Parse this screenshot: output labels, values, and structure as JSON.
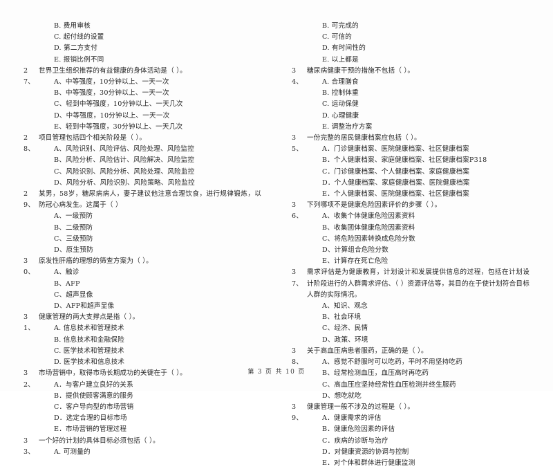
{
  "document": {
    "footer": {
      "prefix": "第",
      "current_page": "3",
      "middle": "页  共",
      "total_pages": "10",
      "suffix": "页"
    }
  },
  "left_column": {
    "continued_options": [
      "B. 费用审核",
      "C. 起付线的设置",
      "D. 第二方支付",
      "E. 报销比例不同"
    ],
    "questions": [
      {
        "number": "27、",
        "stem": "世界卫生组织推荐的有益健康的身体活动是（      ）。",
        "options": [
          "A、中等强度，10分钟以上、一天一次",
          "B、中等强度，30分钟以上、一天一次",
          "C、轻到中等强度，10分钟以上、一天几次",
          "D、中等强度，10分钟以上、一天一次",
          "E、轻到中等强度，30分钟以上、一天几次"
        ]
      },
      {
        "number": "28、",
        "stem": "项目管理包括四个相关阶段是（      ）。",
        "options": [
          "A、风险识别、风险评估、风险处理、风险监控",
          "B、风险分析、风险估计、风险解决、风险监控",
          "C、风险识别、风险分析、风险处理、风险监控",
          "D、风险分析、风险识别、风险策略、风险监控"
        ]
      },
      {
        "number": "29、",
        "stem": "某男，58岁，糖尿病病人，妻子建议他注意合理饮食，进行规律锻炼，以防冠心病发生。这属于（    ）",
        "options": [
          "A、一级预防",
          "B、二级预防",
          "C、三级预防",
          "D、原生预防"
        ]
      },
      {
        "number": "30、",
        "stem": "原发性肝癌的理想的筛查方案为（      ）。",
        "options": [
          "A、触诊",
          "B、AFP",
          "C、超声显像",
          "D、AFP和超声显像"
        ]
      },
      {
        "number": "31、",
        "stem": "健康管理的两大支撑点是指（      ）。",
        "options": [
          "A. 信息技术和管理技术",
          "B. 信息技术和金融保险",
          "C. 医学技术和管理技术",
          "D. 医学技术和信息技术"
        ]
      },
      {
        "number": "32、",
        "stem": "市场营销中，取得市场长期成功的关键在于（      ）。",
        "options": [
          "A．与客户建立良好的关系",
          "B．提供使顾客满意的服务",
          "C．客户导向型的市场营销",
          "D．选定合理的目标市场",
          "E．市场营销的管理过程"
        ]
      },
      {
        "number": "33、",
        "stem": "一个好的计划的具体目标必须包括（       ）。",
        "options": [
          "A. 可测量的"
        ]
      }
    ]
  },
  "right_column": {
    "continued_options": [
      "B. 可完成的",
      "C. 可信的",
      "D. 有时间性的",
      "E. 以上都是"
    ],
    "questions": [
      {
        "number": "34、",
        "stem": "糖尿病健康干预的措施不包括（      ）。",
        "options": [
          "A. 合理膳食",
          "B. 控制体重",
          "C. 运动保健",
          "D. 心理健康",
          "E. 调整治疗方案"
        ]
      },
      {
        "number": "35、",
        "stem": "一份完整的居民健康档案应包括（      ）。",
        "options": [
          "A．门诊健康档案、医院健康档案、社区健康档案",
          "B．个人健康档案、家庭健康档案、社区健康档案P318",
          "C．门诊健康档案、个人健康档案、家庭健康档案",
          "D．个人健康档案、家庭健康档案、医院健康档案",
          "E．个人健康档案、医院健康档案、社区健康档案"
        ]
      },
      {
        "number": "36、",
        "stem": "下列哪项不是健康危险因素评价的步骤（      ）。",
        "options": [
          "A、收集个体健康危险因素资料",
          "B、收集团体健康危险因素资料",
          "C、将危险因素转换成危险分数",
          "D、计算组合危险分数",
          "E、计算存在死亡危险"
        ]
      },
      {
        "number": "37、",
        "stem": "需求评估是为健康教育，计划设计和发展提供信息的过程，包括在计划设计阶段进行的人群需求评估、（      ）资源评估等，其目的在于使计划符合目标人群的实际情况。",
        "options": [
          "A、知识、观念",
          "B、社会环境",
          "C、经济、民情",
          "D、政策、环境"
        ]
      },
      {
        "number": "38、",
        "stem": "关于高血压病患者服药，正确的是（      ）。",
        "options": [
          "A、感觉不舒服时可以吃药，平时不用坚持吃药",
          "B、经常检测血压，血压高时再吃药",
          "C、高血压应坚持经常性血压检测并终生服药",
          "D、想吃就吃"
        ]
      },
      {
        "number": "39、",
        "stem": "健康管理一般不涉及的过程是（      ）。",
        "options": [
          "A．健康需求的评估",
          "B．健康危险因素的评估",
          "C．疾病的诊断与治疗",
          "D．对健康资源的协调与控制",
          "E．对个体和群体进行健康监测"
        ]
      }
    ]
  }
}
